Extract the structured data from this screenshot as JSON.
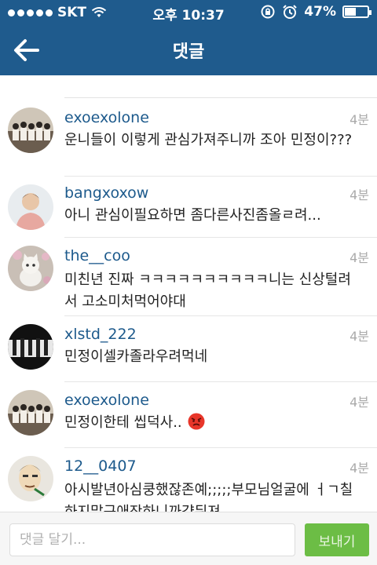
{
  "status_bar": {
    "carrier": "SKT",
    "time": "오후 10:37",
    "battery": "47%",
    "battery_level": 0.47,
    "signal_icon": "signal-dots-icon",
    "wifi_icon": "wifi-icon",
    "lock_icon": "rotation-lock-icon",
    "alarm_icon": "alarm-clock-icon"
  },
  "nav": {
    "title": "댓글",
    "back_icon": "arrow-left-icon"
  },
  "comments": [
    {
      "username": "exoexolone",
      "time": "4분",
      "text": "운니들이 이렇게 관심가져주니까 조아 민정이???"
    },
    {
      "username": "bangxoxow",
      "time": "4분",
      "text": "아니 관심이필요하면 좀다른사진좀올ㄹ려..."
    },
    {
      "username": "the__coo",
      "time": "4분",
      "text": "미친년 진짜 ㅋㅋㅋㅋㅋㅋㅋㅋㅋㅋ니는 신상털려서 고소미처먹어야대"
    },
    {
      "username": "xlstd_222",
      "time": "4분",
      "text": "민정이셀카졸라우려먹네"
    },
    {
      "username": "exoexolone",
      "time": "4분",
      "text": "민정이한테 씹덕사..",
      "emoji": "angry-face-icon"
    },
    {
      "username": "12__0407",
      "time": "4분",
      "text": "아시발년아심쿵했잖존예;;;;;부모님얼굴에 ㅓㄱ칠하지말구애잔하니까걍뒤져"
    }
  ],
  "composer": {
    "placeholder": "댓글 달기...",
    "send_label": "보내기"
  },
  "colors": {
    "header": "#1f5b8d",
    "username": "#1d5a8c",
    "send_button": "#6cbd45"
  }
}
